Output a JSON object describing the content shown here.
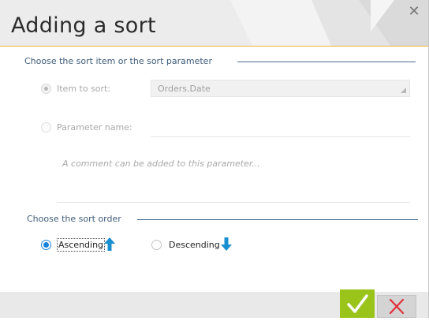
{
  "dialog": {
    "title": "Adding a sort",
    "close_icon": "close-icon"
  },
  "item_group": {
    "title": "Choose the sort item or the sort parameter",
    "item_to_sort": {
      "label": "Item to sort:",
      "selected": true,
      "enabled": false,
      "value": "Orders.Date"
    },
    "parameter_name": {
      "label": "Parameter name:",
      "selected": false,
      "enabled": false,
      "value": ""
    },
    "comment_placeholder": "A comment can be added to this parameter..."
  },
  "order_group": {
    "title": "Choose the sort order",
    "ascending": {
      "label": "Ascending",
      "selected": true,
      "icon": "arrow-up-icon"
    },
    "descending": {
      "label": "Descending",
      "selected": false,
      "icon": "arrow-down-icon"
    }
  },
  "footer": {
    "ok_icon": "checkmark-icon",
    "cancel_icon": "close-icon"
  },
  "colors": {
    "accent": "#f0b43c",
    "ok": "#9bc41b",
    "cancel_x": "#e0323a",
    "selection": "#1a82d9",
    "sort_arrow": "#1a8fd0",
    "group_title": "#3f5c7a"
  }
}
